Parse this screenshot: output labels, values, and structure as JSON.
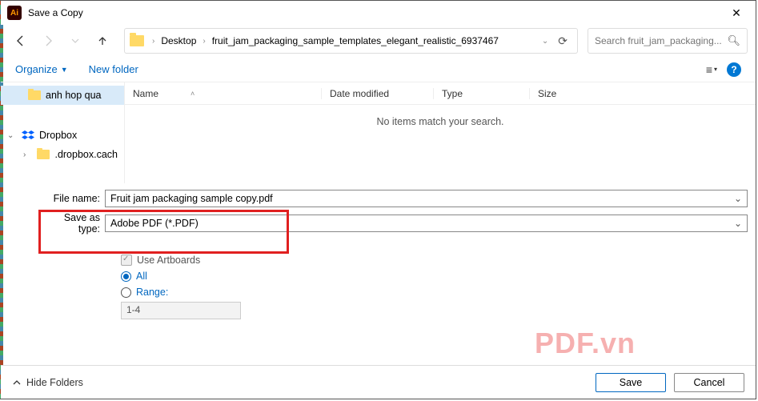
{
  "title": "Save a Copy",
  "breadcrumb": {
    "a": "Desktop",
    "b": "fruit_jam_packaging_sample_templates_elegant_realistic_6937467"
  },
  "search": {
    "placeholder": "Search fruit_jam_packaging..."
  },
  "toolbar": {
    "organize": "Organize",
    "newfolder": "New folder"
  },
  "sidebar": {
    "items": [
      {
        "label": "anh hop qua"
      },
      {
        "label": "Dropbox"
      },
      {
        "label": ".dropbox.cach"
      }
    ]
  },
  "columns": {
    "name": "Name",
    "date": "Date modified",
    "type": "Type",
    "size": "Size"
  },
  "empty": "No items match your search.",
  "form": {
    "filename_label": "File name:",
    "filename_value": "Fruit jam packaging sample copy.pdf",
    "type_label": "Save as type:",
    "type_value": "Adobe PDF (*.PDF)"
  },
  "artboards": {
    "use": "Use Artboards",
    "all": "All",
    "range": "Range:",
    "range_value": "1-4"
  },
  "watermark": "PDF.vn",
  "footer": {
    "hide": "Hide Folders",
    "save": "Save",
    "cancel": "Cancel"
  }
}
